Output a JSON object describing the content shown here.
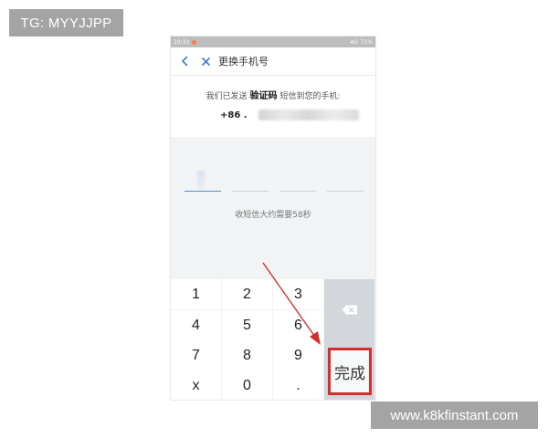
{
  "watermarks": {
    "top_left": "TG: MYYJJPP",
    "bottom_right": "www.k8kfinstant.com"
  },
  "statusbar": {
    "time": "10:33",
    "signal_text": "4G",
    "battery": "71%"
  },
  "header": {
    "title": "更换手机号",
    "back_icon": "chevron-left-icon",
    "close_icon": "close-icon"
  },
  "message": {
    "before": "我们已发送",
    "highlight": "验证码",
    "after": "短信到您的手机:",
    "phone_prefix": "+86 ."
  },
  "code": {
    "slots": [
      "",
      "",
      "",
      ""
    ]
  },
  "countdown": "收短信大约需要58秒",
  "keypad": {
    "keys": [
      "1",
      "2",
      "3",
      "4",
      "5",
      "6",
      "7",
      "8",
      "9",
      "x",
      "0",
      "."
    ],
    "backspace_icon": "backspace-icon",
    "done_label": "完成"
  },
  "colors": {
    "accent": "#4a90d9",
    "highlight_border": "#d0312d",
    "arrow": "#d0312d"
  }
}
